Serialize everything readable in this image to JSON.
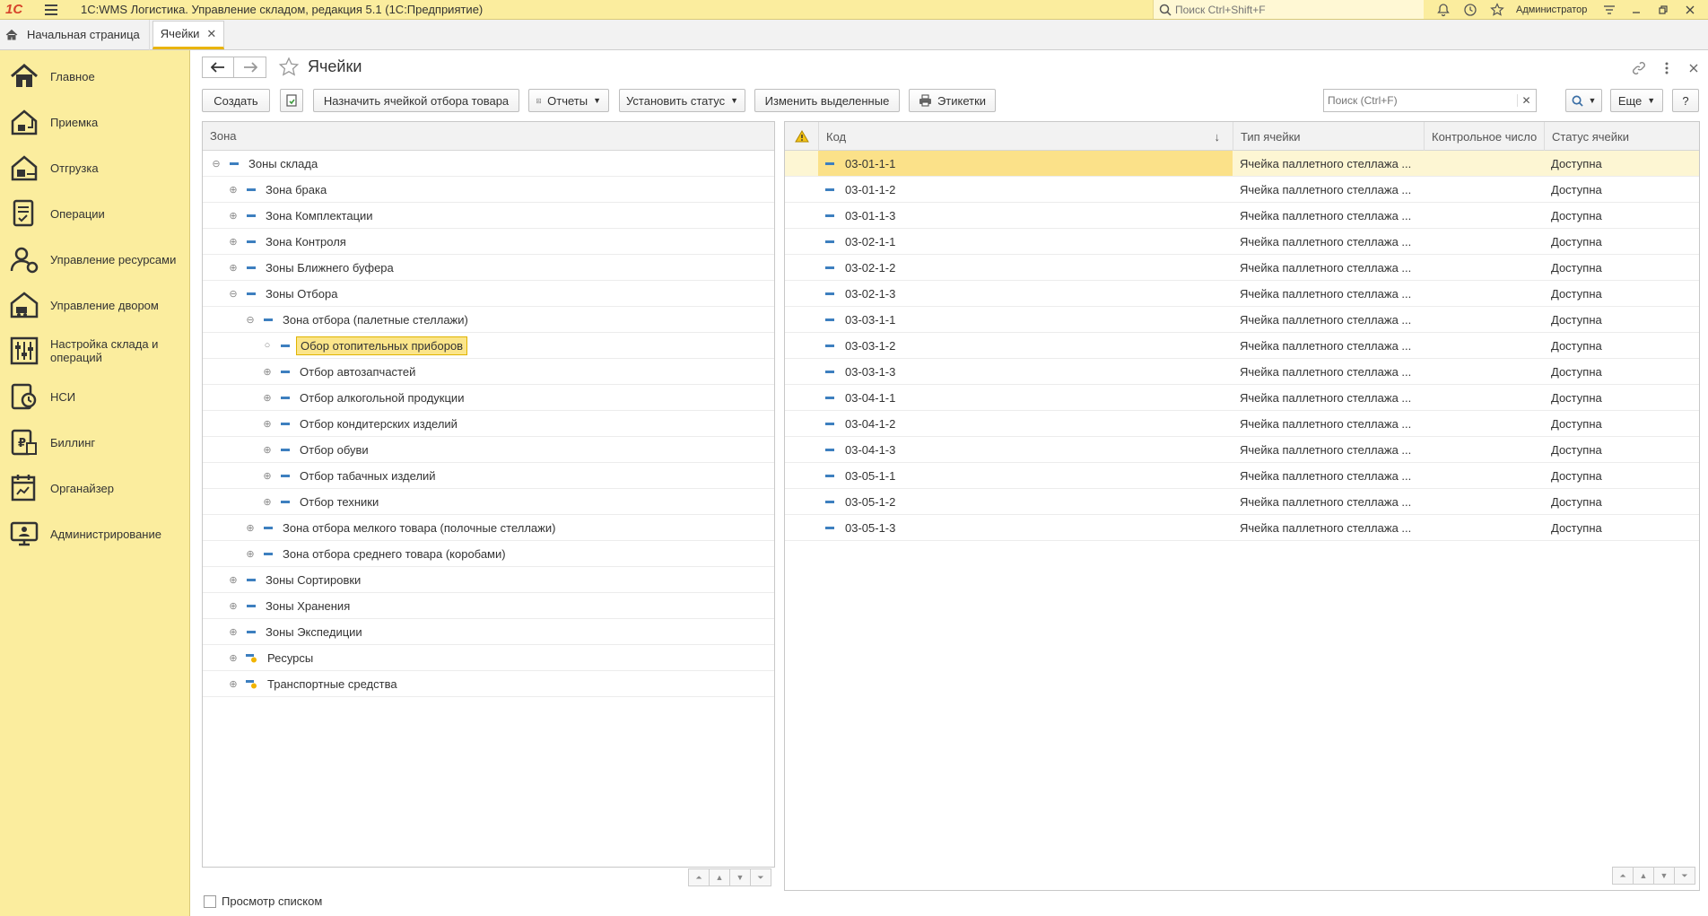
{
  "app": {
    "logo": "1С",
    "title": "1С:WMS Логистика. Управление складом, редакция 5.1  (1С:Предприятие)",
    "search_placeholder": "Поиск Ctrl+Shift+F",
    "user": "Администратор"
  },
  "tabs": {
    "home": "Начальная страница",
    "active": "Ячейки"
  },
  "sidebar": {
    "items": [
      {
        "label": "Главное",
        "icon": "home-icon"
      },
      {
        "label": "Приемка",
        "icon": "receiving-icon"
      },
      {
        "label": "Отгрузка",
        "icon": "shipping-icon"
      },
      {
        "label": "Операции",
        "icon": "operations-icon"
      },
      {
        "label": "Управление ресурсами",
        "icon": "resources-icon"
      },
      {
        "label": "Управление двором",
        "icon": "yard-icon"
      },
      {
        "label": "Настройка склада и операций",
        "icon": "settings-icon"
      },
      {
        "label": "НСИ",
        "icon": "reference-icon"
      },
      {
        "label": "Биллинг",
        "icon": "billing-icon"
      },
      {
        "label": "Органайзер",
        "icon": "organizer-icon"
      },
      {
        "label": "Администрирование",
        "icon": "admin-icon"
      }
    ]
  },
  "page": {
    "title": "Ячейки"
  },
  "toolbar": {
    "create": "Создать",
    "assign": "Назначить ячейкой отбора товара",
    "reports": "Отчеты",
    "set_status": "Установить статус",
    "edit_selected": "Изменить выделенные",
    "labels": "Этикетки",
    "search_placeholder": "Поиск (Ctrl+F)",
    "more": "Еще",
    "help": "?"
  },
  "tree": {
    "header": "Зона",
    "rows": [
      {
        "label": "Зоны склада",
        "exp": "⊖",
        "level": 0,
        "kind": "group"
      },
      {
        "label": "Зона брака",
        "exp": "⊕",
        "level": 1,
        "kind": "group"
      },
      {
        "label": "Зона Комплектации",
        "exp": "⊕",
        "level": 1,
        "kind": "group"
      },
      {
        "label": "Зона Контроля",
        "exp": "⊕",
        "level": 1,
        "kind": "group"
      },
      {
        "label": "Зоны Ближнего буфера",
        "exp": "⊕",
        "level": 1,
        "kind": "group"
      },
      {
        "label": "Зоны Отбора",
        "exp": "⊖",
        "level": 1,
        "kind": "group"
      },
      {
        "label": "Зона отбора (палетные стеллажи)",
        "exp": "⊖",
        "level": 2,
        "kind": "group"
      },
      {
        "label": "Обор отопительных приборов",
        "exp": "○",
        "level": 3,
        "kind": "group",
        "selected": true
      },
      {
        "label": "Отбор автозапчастей",
        "exp": "⊕",
        "level": 3,
        "kind": "group"
      },
      {
        "label": "Отбор алкогольной продукции",
        "exp": "⊕",
        "level": 3,
        "kind": "group"
      },
      {
        "label": "Отбор кондитерских изделий",
        "exp": "⊕",
        "level": 3,
        "kind": "group"
      },
      {
        "label": "Отбор обуви",
        "exp": "⊕",
        "level": 3,
        "kind": "group"
      },
      {
        "label": "Отбор табачных изделий",
        "exp": "⊕",
        "level": 3,
        "kind": "group"
      },
      {
        "label": "Отбор техники",
        "exp": "⊕",
        "level": 3,
        "kind": "group"
      },
      {
        "label": "Зона отбора мелкого товара (полочные стеллажи)",
        "exp": "⊕",
        "level": 2,
        "kind": "group"
      },
      {
        "label": "Зона отбора среднего товара (коробами)",
        "exp": "⊕",
        "level": 2,
        "kind": "group"
      },
      {
        "label": "Зоны Сортировки",
        "exp": "⊕",
        "level": 1,
        "kind": "group"
      },
      {
        "label": "Зоны Хранения",
        "exp": "⊕",
        "level": 1,
        "kind": "group"
      },
      {
        "label": "Зоны Экспедиции",
        "exp": "⊕",
        "level": 1,
        "kind": "group"
      },
      {
        "label": "Ресурсы",
        "exp": "⊕",
        "level": 1,
        "kind": "resource"
      },
      {
        "label": "Транспортные средства",
        "exp": "⊕",
        "level": 1,
        "kind": "resource"
      }
    ]
  },
  "list": {
    "columns": {
      "code": "Код",
      "sort": "↓",
      "type": "Тип ячейки",
      "control": "Контрольное число",
      "status": "Статус ячейки"
    },
    "rows": [
      {
        "code": "03-01-1-1",
        "type": "Ячейка паллетного стеллажа ...",
        "control": "",
        "status": "Доступна"
      },
      {
        "code": "03-01-1-2",
        "type": "Ячейка паллетного стеллажа ...",
        "control": "",
        "status": "Доступна"
      },
      {
        "code": "03-01-1-3",
        "type": "Ячейка паллетного стеллажа ...",
        "control": "",
        "status": "Доступна"
      },
      {
        "code": "03-02-1-1",
        "type": "Ячейка паллетного стеллажа ...",
        "control": "",
        "status": "Доступна"
      },
      {
        "code": "03-02-1-2",
        "type": "Ячейка паллетного стеллажа ...",
        "control": "",
        "status": "Доступна"
      },
      {
        "code": "03-02-1-3",
        "type": "Ячейка паллетного стеллажа ...",
        "control": "",
        "status": "Доступна"
      },
      {
        "code": "03-03-1-1",
        "type": "Ячейка паллетного стеллажа ...",
        "control": "",
        "status": "Доступна"
      },
      {
        "code": "03-03-1-2",
        "type": "Ячейка паллетного стеллажа ...",
        "control": "",
        "status": "Доступна"
      },
      {
        "code": "03-03-1-3",
        "type": "Ячейка паллетного стеллажа ...",
        "control": "",
        "status": "Доступна"
      },
      {
        "code": "03-04-1-1",
        "type": "Ячейка паллетного стеллажа ...",
        "control": "",
        "status": "Доступна"
      },
      {
        "code": "03-04-1-2",
        "type": "Ячейка паллетного стеллажа ...",
        "control": "",
        "status": "Доступна"
      },
      {
        "code": "03-04-1-3",
        "type": "Ячейка паллетного стеллажа ...",
        "control": "",
        "status": "Доступна"
      },
      {
        "code": "03-05-1-1",
        "type": "Ячейка паллетного стеллажа ...",
        "control": "",
        "status": "Доступна"
      },
      {
        "code": "03-05-1-2",
        "type": "Ячейка паллетного стеллажа ...",
        "control": "",
        "status": "Доступна"
      },
      {
        "code": "03-05-1-3",
        "type": "Ячейка паллетного стеллажа ...",
        "control": "",
        "status": "Доступна"
      }
    ]
  },
  "footer": {
    "list_view": "Просмотр списком"
  },
  "colors": {
    "sidebar_bg": "#fbed9e",
    "accent": "#e9b400",
    "selection": "#fbe189",
    "row_marker": "#3d7fbf"
  }
}
